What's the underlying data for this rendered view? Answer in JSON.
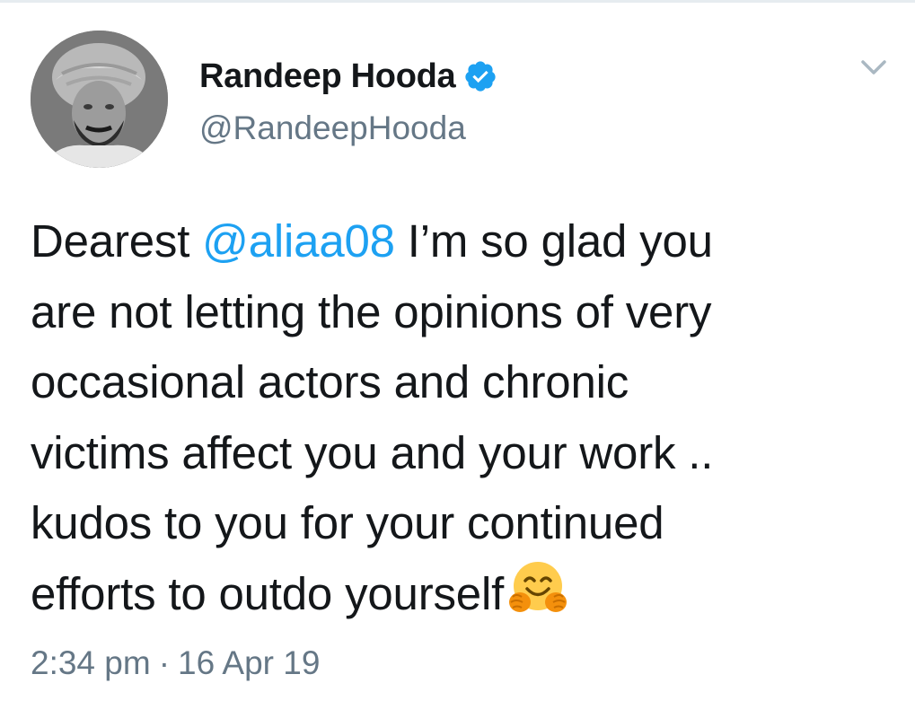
{
  "tweet": {
    "author": {
      "display_name": "Randeep Hooda",
      "handle": "@RandeepHooda",
      "verified": true
    },
    "text": {
      "line1_before": "Dearest ",
      "mention": "@aliaa08",
      "line1_after": " I’m so glad you",
      "line2": "are not letting the opinions of very",
      "line3": "occasional actors and chronic",
      "line4": "victims affect you and your work ..",
      "line5": "kudos to you for your continued",
      "line6": "efforts to outdo yourself"
    },
    "emoji_icon": "hugging-face-icon",
    "time": "2:34 pm",
    "separator": "·",
    "date": "16 Apr 19"
  },
  "colors": {
    "mention": "#1da1f2",
    "verified": "#1da1f2",
    "secondary_text": "#657786",
    "primary_text": "#14171a"
  },
  "icons": {
    "verified": "verified-badge-icon",
    "menu": "chevron-down-icon",
    "avatar": "profile-photo"
  }
}
